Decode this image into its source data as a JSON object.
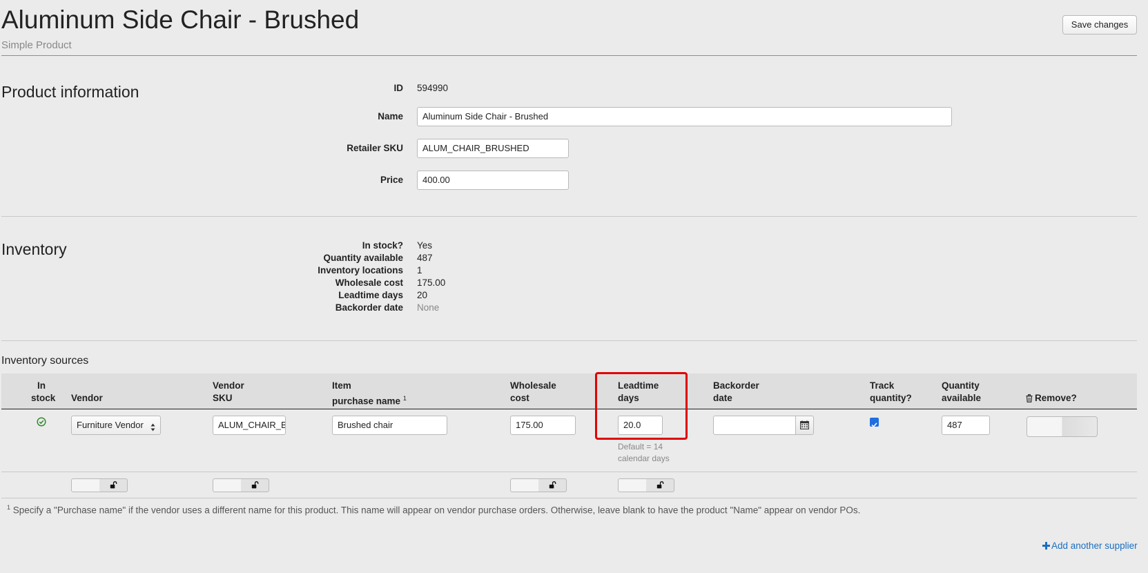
{
  "header": {
    "title": "Aluminum Side Chair - Brushed",
    "subtitle": "Simple Product",
    "save_label": "Save changes"
  },
  "product_info": {
    "heading": "Product information",
    "id_label": "ID",
    "id_value": "594990",
    "name_label": "Name",
    "name_value": "Aluminum Side Chair - Brushed",
    "sku_label": "Retailer SKU",
    "sku_value": "ALUM_CHAIR_BRUSHED",
    "price_label": "Price",
    "price_value": "400.00"
  },
  "inventory": {
    "heading": "Inventory",
    "rows": [
      {
        "label": "In stock?",
        "value": "Yes"
      },
      {
        "label": "Quantity available",
        "value": "487"
      },
      {
        "label": "Inventory locations",
        "value": "1"
      },
      {
        "label": "Wholesale cost",
        "value": "175.00"
      },
      {
        "label": "Leadtime days",
        "value": "20"
      },
      {
        "label": "Backorder date",
        "value": "None"
      }
    ]
  },
  "sources": {
    "heading": "Inventory sources",
    "columns": {
      "in_stock": [
        "In",
        "stock"
      ],
      "vendor": [
        "",
        "Vendor"
      ],
      "vendor_sku": [
        "Vendor",
        "SKU"
      ],
      "item_purchase_name": [
        "Item",
        "purchase name"
      ],
      "item_purchase_name_sup": "1",
      "wholesale_cost": [
        "Wholesale",
        "cost"
      ],
      "leadtime_days": [
        "Leadtime",
        "days"
      ],
      "backorder_date": [
        "Backorder",
        "date"
      ],
      "track_quantity": [
        "Track",
        "quantity?"
      ],
      "quantity_available": [
        "Quantity",
        "available"
      ],
      "remove": "Remove?"
    },
    "row": {
      "in_stock": true,
      "vendor": "Furniture Vendor",
      "vendor_sku": "ALUM_CHAIR_BRUSHED",
      "item_purchase_name": "Brushed chair",
      "wholesale_cost": "175.00",
      "leadtime_days": "20.0",
      "leadtime_hint_1": "Default = 14",
      "leadtime_hint_2": "calendar days",
      "backorder_date": "",
      "track_quantity": true,
      "quantity_available": "487"
    },
    "footnote_marker": "1",
    "footnote": "Specify a \"Purchase name\" if the vendor uses a different name for this product. This name will appear on vendor purchase orders. Otherwise, leave blank to have the product \"Name\" appear on vendor POs.",
    "add_supplier": "Add another supplier"
  },
  "icons": {
    "in_stock": "check-circle-icon",
    "vendor_select": "select-arrows-icon",
    "calendar": "calendar-icon",
    "lock": "unlock-icon",
    "checkbox": "checkbox-checked-icon",
    "trash": "trash-icon",
    "plus": "plus-icon"
  },
  "colors": {
    "background": "#ebebeb",
    "link": "#1a6fc0",
    "success": "#2e8b2e",
    "highlight": "#e00000",
    "checkbox": "#1f6fe0"
  }
}
